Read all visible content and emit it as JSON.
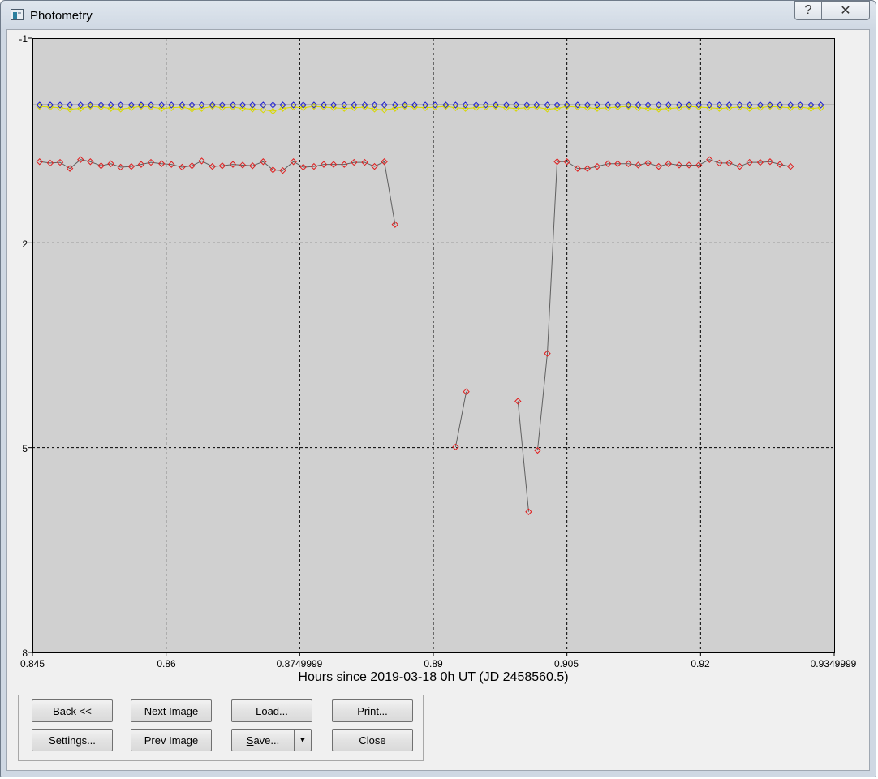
{
  "window": {
    "title": "Photometry",
    "help_glyph": "?",
    "close_glyph": "✕"
  },
  "chart_data": {
    "type": "scatter",
    "xlabel": "Hours since 2019-03-18 0h UT (JD 2458560.5)",
    "xlim": [
      0.845,
      0.9349999
    ],
    "ylim": [
      -1,
      8
    ],
    "y_inverted": true,
    "x_tick_labels": [
      "0.845",
      "0.86",
      "0.8749999",
      "0.89",
      "0.905",
      "0.92",
      "0.9349999"
    ],
    "x_ticks": [
      0.845,
      0.86,
      0.875,
      0.89,
      0.905,
      0.92,
      0.935
    ],
    "y_tick_labels": [
      "-1",
      "2",
      "5",
      "8"
    ],
    "y_ticks": [
      -1,
      2,
      5,
      8
    ],
    "grid": true,
    "reference_line": -0.02,
    "colors": {
      "background": "#d0d0d0",
      "target": "#e02020",
      "comparison": "#2020d0",
      "check": "#d8d800",
      "connector": "#606060",
      "grid": "#000000"
    },
    "series": [
      {
        "marker": "diamond",
        "color": "#2020d0",
        "x": [
          0.8458,
          0.847,
          0.8481,
          0.8492,
          0.8504,
          0.8515,
          0.8527,
          0.8538,
          0.8549,
          0.8561,
          0.8572,
          0.8583,
          0.8595,
          0.8606,
          0.8618,
          0.8629,
          0.864,
          0.8652,
          0.8663,
          0.8675,
          0.8686,
          0.8697,
          0.8709,
          0.872,
          0.8731,
          0.8743,
          0.8754,
          0.8766,
          0.8777,
          0.8788,
          0.88,
          0.8811,
          0.8823,
          0.8834,
          0.8845,
          0.8857,
          0.8868,
          0.8879,
          0.8891,
          0.8902,
          0.8914,
          0.8925,
          0.8936,
          0.8948,
          0.8959,
          0.897,
          0.8982,
          0.8993,
          0.9005,
          0.9016,
          0.9028,
          0.9039,
          0.905,
          0.9062,
          0.9073,
          0.9084,
          0.9096,
          0.9107,
          0.9119,
          0.913,
          0.9141,
          0.9153,
          0.9164,
          0.9176,
          0.9187,
          0.9198,
          0.921,
          0.9221,
          0.9232,
          0.9244,
          0.9255,
          0.9267,
          0.9278,
          0.9289,
          0.9301,
          0.9312,
          0.9324,
          0.9335
        ],
        "y": [
          -0.02,
          -0.02,
          -0.02,
          -0.02,
          -0.02,
          -0.02,
          -0.02,
          -0.02,
          -0.02,
          -0.02,
          -0.02,
          -0.02,
          -0.02,
          -0.02,
          -0.02,
          -0.02,
          -0.02,
          -0.02,
          -0.02,
          -0.02,
          -0.02,
          -0.02,
          -0.02,
          -0.02,
          -0.02,
          -0.02,
          -0.02,
          -0.02,
          -0.02,
          -0.02,
          -0.02,
          -0.02,
          -0.02,
          -0.02,
          -0.02,
          -0.02,
          -0.02,
          -0.02,
          -0.02,
          -0.02,
          -0.02,
          -0.02,
          -0.02,
          -0.02,
          -0.02,
          -0.02,
          -0.02,
          -0.02,
          -0.02,
          -0.02,
          -0.02,
          -0.02,
          -0.02,
          -0.02,
          -0.02,
          -0.02,
          -0.02,
          -0.02,
          -0.02,
          -0.02,
          -0.02,
          -0.02,
          -0.02,
          -0.02,
          -0.02,
          -0.02,
          -0.02,
          -0.02,
          -0.02,
          -0.02,
          -0.02,
          -0.02,
          -0.02,
          -0.02,
          -0.02,
          -0.02,
          -0.02,
          -0.02
        ]
      },
      {
        "marker": "diamond",
        "color": "#d8d800",
        "x": [
          0.8458,
          0.847,
          0.8481,
          0.8492,
          0.8504,
          0.8515,
          0.8527,
          0.8538,
          0.8549,
          0.8561,
          0.8572,
          0.8583,
          0.8595,
          0.8606,
          0.8618,
          0.8629,
          0.864,
          0.8652,
          0.8663,
          0.8675,
          0.8686,
          0.8697,
          0.8709,
          0.872,
          0.8731,
          0.8743,
          0.8754,
          0.8766,
          0.8777,
          0.8788,
          0.88,
          0.8811,
          0.8823,
          0.8834,
          0.8845,
          0.8857,
          0.8868,
          0.8879,
          0.8891,
          0.8902,
          0.8914,
          0.8925,
          0.8936,
          0.8948,
          0.8959,
          0.897,
          0.8982,
          0.8993,
          0.9005,
          0.9016,
          0.9028,
          0.9039,
          0.905,
          0.9062,
          0.9073,
          0.9084,
          0.9096,
          0.9107,
          0.9119,
          0.913,
          0.9141,
          0.9153,
          0.9164,
          0.9176,
          0.9187,
          0.9198,
          0.921,
          0.9221,
          0.9232,
          0.9244,
          0.9255,
          0.9267,
          0.9278,
          0.9289,
          0.9301,
          0.9312,
          0.9324,
          0.9335
        ],
        "y": [
          0.0,
          0.01,
          0.02,
          0.04,
          0.03,
          0.0,
          0.01,
          0.03,
          0.04,
          0.02,
          0.0,
          0.01,
          0.03,
          0.02,
          0.01,
          0.04,
          0.03,
          0.0,
          0.02,
          0.01,
          0.03,
          0.04,
          0.05,
          0.07,
          0.03,
          0.01,
          0.02,
          0.0,
          0.01,
          0.02,
          0.03,
          0.02,
          0.01,
          0.04,
          0.05,
          0.03,
          0.0,
          0.01,
          0.02,
          0.01,
          0.0,
          0.02,
          0.03,
          0.02,
          0.01,
          0.0,
          0.02,
          0.03,
          0.02,
          0.01,
          0.04,
          0.03,
          0.0,
          0.01,
          0.02,
          0.03,
          0.02,
          0.01,
          0.0,
          0.02,
          0.03,
          0.04,
          0.03,
          0.02,
          0.0,
          0.01,
          0.02,
          0.03,
          0.02,
          0.01,
          0.03,
          0.02,
          0.0,
          0.01,
          0.02,
          0.01,
          0.03,
          0.02
        ]
      },
      {
        "marker": "diamond",
        "color": "#e02020",
        "segments": [
          {
            "x": [
              0.8458,
              0.847,
              0.8481,
              0.8492,
              0.8504,
              0.8515,
              0.8527,
              0.8538,
              0.8549,
              0.8561,
              0.8572,
              0.8583,
              0.8595,
              0.8606,
              0.8618,
              0.8629,
              0.864,
              0.8652,
              0.8663,
              0.8675,
              0.8686,
              0.8697,
              0.8709,
              0.872,
              0.8731,
              0.8743,
              0.8754,
              0.8766,
              0.8777,
              0.8788,
              0.88,
              0.8811,
              0.8823,
              0.8834,
              0.8845,
              0.8857,
              0.8868,
              0.8879,
              0.8891,
              0.8902
            ],
            "y": [
              0.81,
              0.83,
              0.82,
              0.91,
              0.78,
              0.81,
              0.87,
              0.84,
              0.89,
              0.88,
              0.85,
              0.82,
              0.84,
              0.85,
              0.89,
              0.87,
              0.8,
              0.88,
              0.87,
              0.85,
              0.86,
              0.87,
              0.81,
              0.93,
              0.94,
              0.81,
              0.89,
              0.88,
              0.85,
              0.85,
              0.85,
              0.82,
              0.82,
              0.88,
              0.81,
              1.73
            ]
          },
          {
            "x": [
              0.8925,
              0.8937
            ],
            "y": [
              4.99,
              4.18
            ]
          },
          {
            "x": [
              0.8995,
              0.9007
            ],
            "y": [
              4.32,
              5.94
            ]
          },
          {
            "x": [
              0.9017,
              0.9028,
              0.9039,
              0.905,
              0.9062,
              0.9073,
              0.9084,
              0.9096,
              0.9107,
              0.9119,
              0.913,
              0.9141,
              0.9153,
              0.9164,
              0.9176,
              0.9187,
              0.9198,
              0.921,
              0.9221,
              0.9232,
              0.9244,
              0.9255,
              0.9267,
              0.9278,
              0.9289,
              0.9301,
              0.9312,
              0.9324,
              0.9335
            ],
            "y": [
              5.04,
              3.62,
              0.81,
              0.81,
              0.91,
              0.91,
              0.88,
              0.84,
              0.84,
              0.84,
              0.86,
              0.83,
              0.88,
              0.84,
              0.86,
              0.86,
              0.86,
              0.78,
              0.83,
              0.83,
              0.88,
              0.82,
              0.82,
              0.81,
              0.85,
              0.88
            ]
          }
        ]
      }
    ]
  },
  "buttons": {
    "back": "Back <<",
    "next_image": "Next Image",
    "load": "Load...",
    "print": "Print...",
    "settings": "Settings...",
    "prev_image": "Prev Image",
    "save_s": "S",
    "save_rest": "ave...",
    "save_arrow": "▼",
    "close": "Close"
  }
}
